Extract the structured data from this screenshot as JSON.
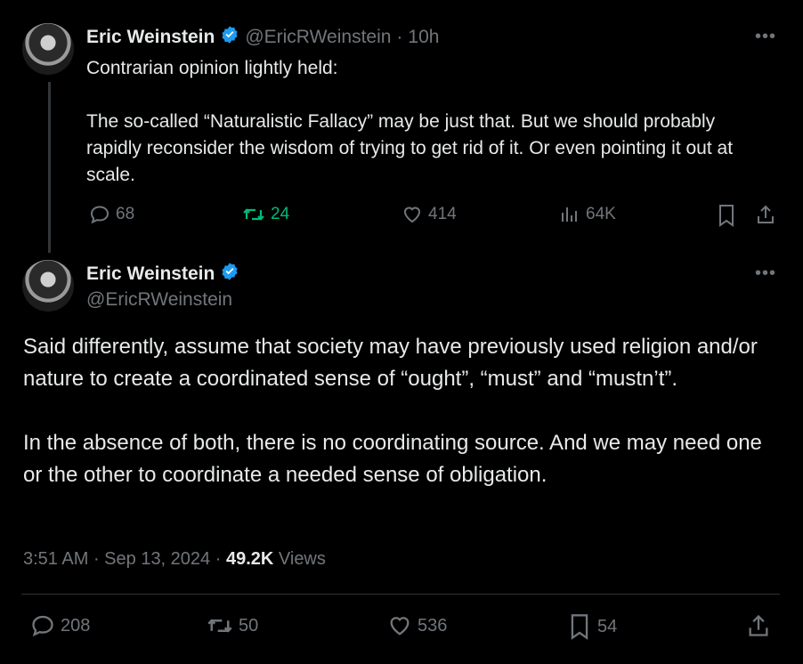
{
  "quoted_tweet": {
    "author_name": "Eric Weinstein",
    "author_handle": "@EricRWeinstein",
    "separator": "·",
    "time_ago": "10h",
    "text": "Contrarian opinion lightly held:\n\nThe so-called “Naturalistic Fallacy” may be just that. But we should probably rapidly reconsider the wisdom of trying to get rid of it. Or even pointing it out at scale.",
    "replies": "68",
    "reposts": "24",
    "likes": "414",
    "views": "64K"
  },
  "main_tweet": {
    "author_name": "Eric Weinstein",
    "author_handle": "@EricRWeinstein",
    "text": "Said differently, assume that society may have previously used religion and/or nature to create a coordinated sense of “ought”, “must” and “mustn’t”.\n\nIn the absence of both, there is no coordinating source. And we may need one or the other to coordinate a needed sense of obligation.",
    "time": "3:51 AM",
    "date": "Sep 13, 2024",
    "views_count": "49.2K",
    "views_label": "Views",
    "replies": "208",
    "reposts": "50",
    "likes": "536",
    "bookmarks": "54"
  },
  "icons": [
    "more-icon",
    "verified-icon",
    "reply-icon",
    "repost-icon",
    "like-icon",
    "views-icon",
    "bookmark-icon",
    "share-icon"
  ],
  "colors": {
    "background": "#000000",
    "text": "#e7e9ea",
    "muted": "#71767b",
    "verified": "#1d9bf0",
    "repost_active": "#00ba7c"
  }
}
